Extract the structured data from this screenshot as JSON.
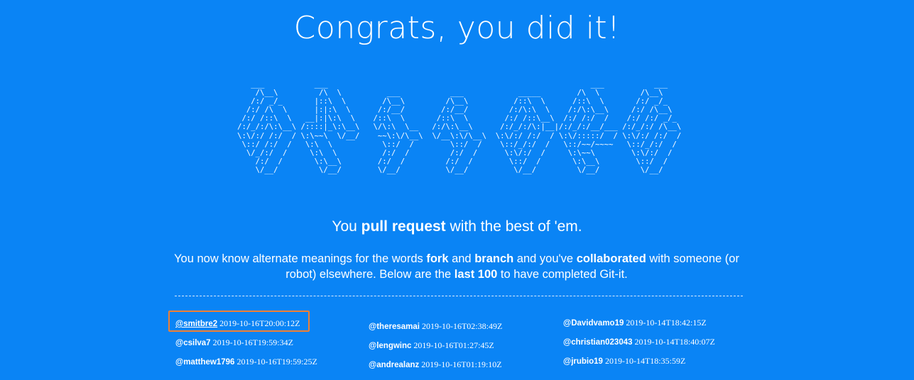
{
  "heading": "Congrats, you did it!",
  "ascii_art": "      ___           ___                                                          ___           ___     \n     /\\__\\         /\\  \\          ___           ___            _____        /\\  \\         /\\__\\    \n    /:/ _/_       |::\\  \\        /\\__\\         /\\__\\          /::\\  \\      /::\\  \\       /:/ _/_   \n   /:/ /\\  \\      |:|:\\  \\      /:/__/        /:/__/         /:/\\:\\  \\    /:/\\:\\__\\     /:/ /\\__\\  \n  /:/ /::\\  \\   __|:|\\:\\  \\    /::\\  \\       /::\\  \\        /:/ /::\\__\\  /:/ /:/  /    /:/ /:/ _/_ \n /:/_/:/\\:\\__\\ /::::|_\\:\\__\\   \\/\\:\\  \\__   /:/\\:\\__\\      /:/_/:/\\:|__|/:/_/:/__/___ /:/_/:/ /\\__\\\n \\:\\/:/ /:/  / \\:\\~~\\  \\/__/    ~~\\:\\/\\__\\  \\/__\\:\\/\\__\\  \\:\\/:/ /:/  / \\:\\/:::::/  / \\:\\/:/ /:/  /\n  \\::/ /:/  /   \\:\\  \\           \\::/  /        \\::/  /    \\::/_/:/  /   \\::/~~/~~~~   \\::/_/:/  / \n   \\/_/:/  /     \\:\\  \\          /:/  /         /:/  /      \\:\\/:/  /     \\:\\~~\\        \\:\\/:/  /  \n     /:/  /       \\:\\__\\        /:/  /         /:/  /        \\::/  /       \\:\\__\\        \\::/  /   \n     \\/__/         \\/__/        \\/__/          \\/__/          \\/__/         \\/__/         \\/__/    ",
  "tagline": {
    "before": "You ",
    "bold1": "pull request",
    "after": " with the best of 'em."
  },
  "description": {
    "t1": "You now know alternate meanings for the words ",
    "b1": "fork",
    "t2": " and ",
    "b2": "branch",
    "t3": " and you've ",
    "b3": "collaborated",
    "t4": " with someone (or robot) elsewhere. Below are the ",
    "b4": "last 100",
    "t5": " to have completed Git-it."
  },
  "completions": {
    "column1": [
      {
        "user": "@smitbre2",
        "time": "2019-10-16T20:00:12Z"
      },
      {
        "user": "@csilva7",
        "time": "2019-10-16T19:59:34Z"
      },
      {
        "user": "@matthew1796",
        "time": "2019-10-16T19:59:25Z"
      }
    ],
    "column2": [
      {
        "user": "@theresamai",
        "time": "2019-10-16T02:38:49Z"
      },
      {
        "user": "@lengwinc",
        "time": "2019-10-16T01:27:45Z"
      },
      {
        "user": "@andrealanz",
        "time": "2019-10-16T01:19:10Z"
      }
    ],
    "column3": [
      {
        "user": "@Davidvamo19",
        "time": "2019-10-14T18:42:15Z"
      },
      {
        "user": "@christian023043",
        "time": "2019-10-14T18:40:07Z"
      },
      {
        "user": "@jrubio19",
        "time": "2019-10-14T18:35:59Z"
      }
    ]
  },
  "colors": {
    "background": "#0a84f5",
    "text": "#ffffff",
    "highlight": "#f07f33"
  }
}
